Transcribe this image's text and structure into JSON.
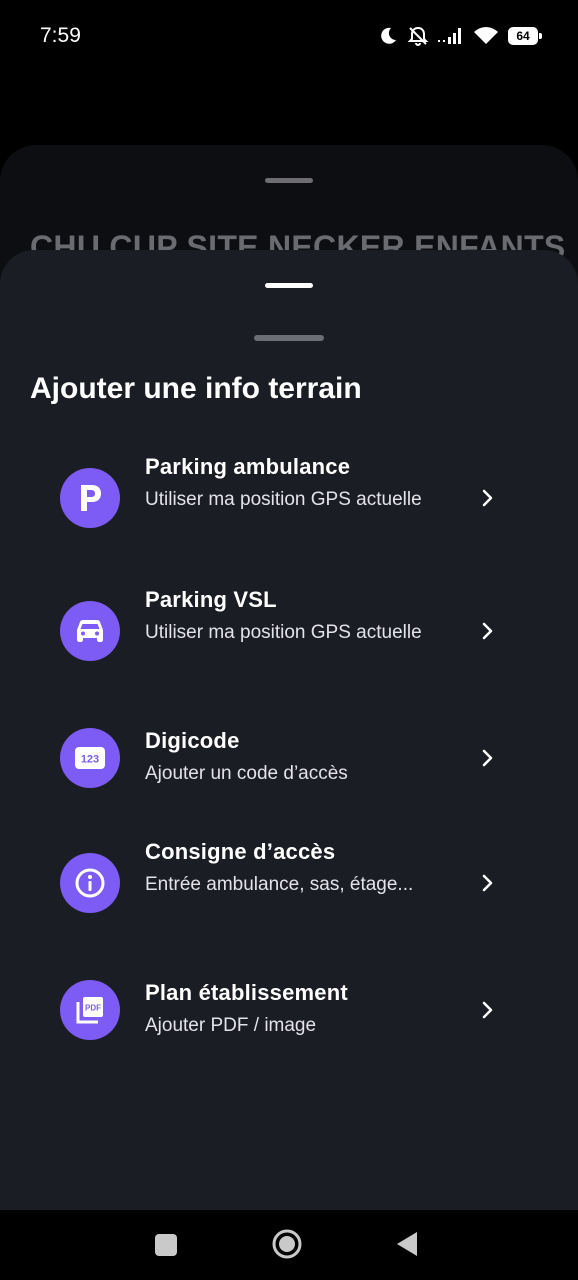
{
  "status_bar": {
    "time": "7:59",
    "battery": "64",
    "icons": [
      "moon-icon",
      "bell-off-icon",
      "signal-icon",
      "wifi-icon",
      "battery-icon"
    ]
  },
  "background_sheet": {
    "title": "CHU CUP SITE NECKER ENFANTS"
  },
  "sheet": {
    "title": "Ajouter une info terrain",
    "options": [
      {
        "label": "Parking ambulance",
        "subtitle": "Utiliser ma position GPS actuelle",
        "icon": "parking-icon"
      },
      {
        "label": "Parking VSL",
        "subtitle": "Utiliser ma position GPS actuelle",
        "icon": "car-icon"
      },
      {
        "label": "Digicode",
        "subtitle": "Ajouter un code d’accès",
        "icon": "keypad-123-icon"
      },
      {
        "label": "Consigne d’accès",
        "subtitle": "Entrée ambulance, sas, étage...",
        "icon": "info-icon"
      },
      {
        "label": "Plan établissement",
        "subtitle": "Ajouter PDF / image",
        "icon": "pdf-icon"
      }
    ]
  },
  "colors": {
    "accent": "#7c5cf5",
    "sheet_bg": "#1b1d24",
    "back_sheet_bg": "#0d0e11"
  },
  "nav_bar": {
    "icons": [
      "recents-icon",
      "home-icon",
      "back-icon"
    ]
  }
}
